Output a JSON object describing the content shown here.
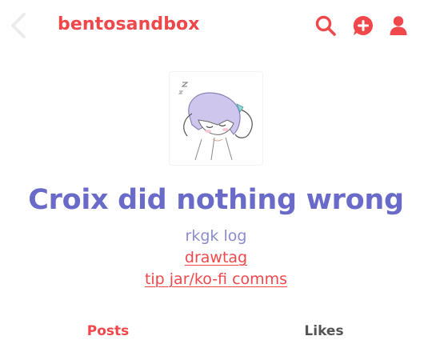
{
  "header": {
    "blog_name": "bentosandbox",
    "icons": {
      "back": "chevron-left-icon",
      "search": "search-icon",
      "compose": "compose-plus-icon",
      "account": "person-icon"
    }
  },
  "profile": {
    "avatar": "sleeping-character-sketch",
    "title": "Croix did nothing wrong",
    "description_text": "rkgk log",
    "links": [
      {
        "label": "drawtag"
      },
      {
        "label": "tip jar/ko-fi comms"
      }
    ]
  },
  "tabs": [
    {
      "label": "Posts",
      "active": true
    },
    {
      "label": "Likes",
      "active": false
    }
  ],
  "colors": {
    "accent": "#f0474b",
    "title": "#6a6bc9",
    "description": "#8a8ccf",
    "inactive_tab": "#555555",
    "icon_light": "#ececec"
  }
}
